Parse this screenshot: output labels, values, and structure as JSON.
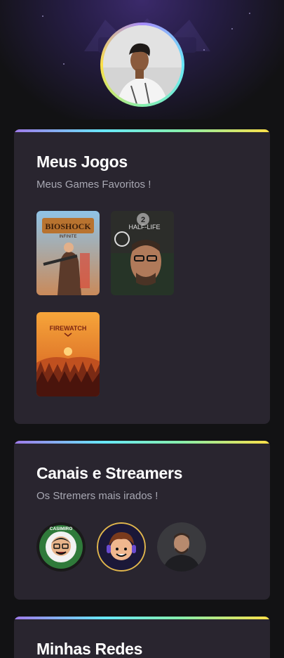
{
  "profile": {
    "avatar_alt": "Foto de perfil"
  },
  "games_card": {
    "title": "Meus Jogos",
    "subtitle": "Meus Games Favoritos !",
    "games": [
      {
        "name": "BIOSHOCK",
        "subname": "INFINITE",
        "icon": "bioshock-cover"
      },
      {
        "name": "HALF-LIFE",
        "badge": "2",
        "icon": "half-life-2-cover"
      },
      {
        "name": "FIREWATCH",
        "icon": "firewatch-cover"
      }
    ]
  },
  "streamers_card": {
    "title": "Canais e Streamers",
    "subtitle": "Os Stremers mais irados !",
    "streamers": [
      {
        "label": "CASIMIRO",
        "icon": "casimiro-avatar"
      },
      {
        "label": "",
        "icon": "streamer-2-avatar"
      },
      {
        "label": "",
        "icon": "streamer-3-avatar"
      }
    ]
  },
  "networks_card": {
    "title": "Minhas Redes"
  }
}
